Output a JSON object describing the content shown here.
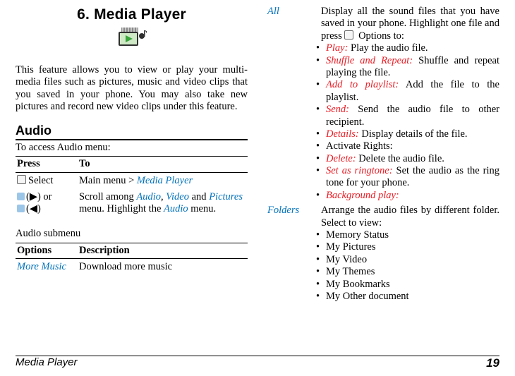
{
  "section": {
    "num": "6.",
    "title": "Media Player"
  },
  "intro": "This feature allows you to view or play your multi-media files such as pictures, music and video clips that you saved in your phone. You may also take new pictures and record new video clips under this feature.",
  "audio": {
    "heading": "Audio",
    "lead": "To access Audio menu:",
    "table1": {
      "h1": "Press",
      "h2": "To",
      "r1c1": "Select",
      "r1c2_pre": "Main menu > ",
      "r1c2_link": "Media Player",
      "r2c1a": "(▶) or",
      "r2c1b": "(◀)",
      "r2c2a": "Scroll among ",
      "r2_audio": "Audio",
      "r2_sep1": ", ",
      "r2_video": "Video",
      "r2_and": " and ",
      "r2_pictures": "Pictures",
      "r2c2b": "menu. Highlight the ",
      "r2_audio2": "Audio",
      "r2_tail": " menu."
    },
    "subcaption": "Audio submenu",
    "table2": {
      "h1": "Options",
      "h2": "Description",
      "r1c1": "More Music",
      "r1c2": "Download more music"
    }
  },
  "right": {
    "all_label": "All",
    "all_body": "Display all the sound files that you have saved in your phone. Highlight one file and press ",
    "all_body_tail": " Options to:",
    "items": {
      "play": {
        "name": "Play:",
        "text": " Play the audio file."
      },
      "shuffle": {
        "name": "Shuffle and Repeat:",
        "text": " Shuffle and repeat playing the file."
      },
      "addpl": {
        "name": "Add to playlist:",
        "text": " Add the file to the playlist."
      },
      "send": {
        "name": "Send:",
        "text": " Send the audio file to other recipient."
      },
      "details": {
        "name": "Details:",
        "text": " Display details of the file."
      },
      "activate": {
        "text": "Activate Rights:"
      },
      "delete": {
        "name": "Delete:",
        "text": " Delete the audio file."
      },
      "ringtone": {
        "name": "Set as ringtone:",
        "text": " Set the audio as the ring tone for your phone."
      },
      "bgplay": {
        "name": "Background play:"
      }
    },
    "folders_label": "Folders",
    "folders_body": "Arrange the audio files by different folder. Select to view:",
    "folders": {
      "f1": "Memory Status",
      "f2": "My Pictures",
      "f3": "My Video",
      "f4": "My Themes",
      "f5": "My Bookmarks",
      "f6": "My Other document"
    }
  },
  "footer": {
    "label": "Media Player",
    "page": "19"
  }
}
